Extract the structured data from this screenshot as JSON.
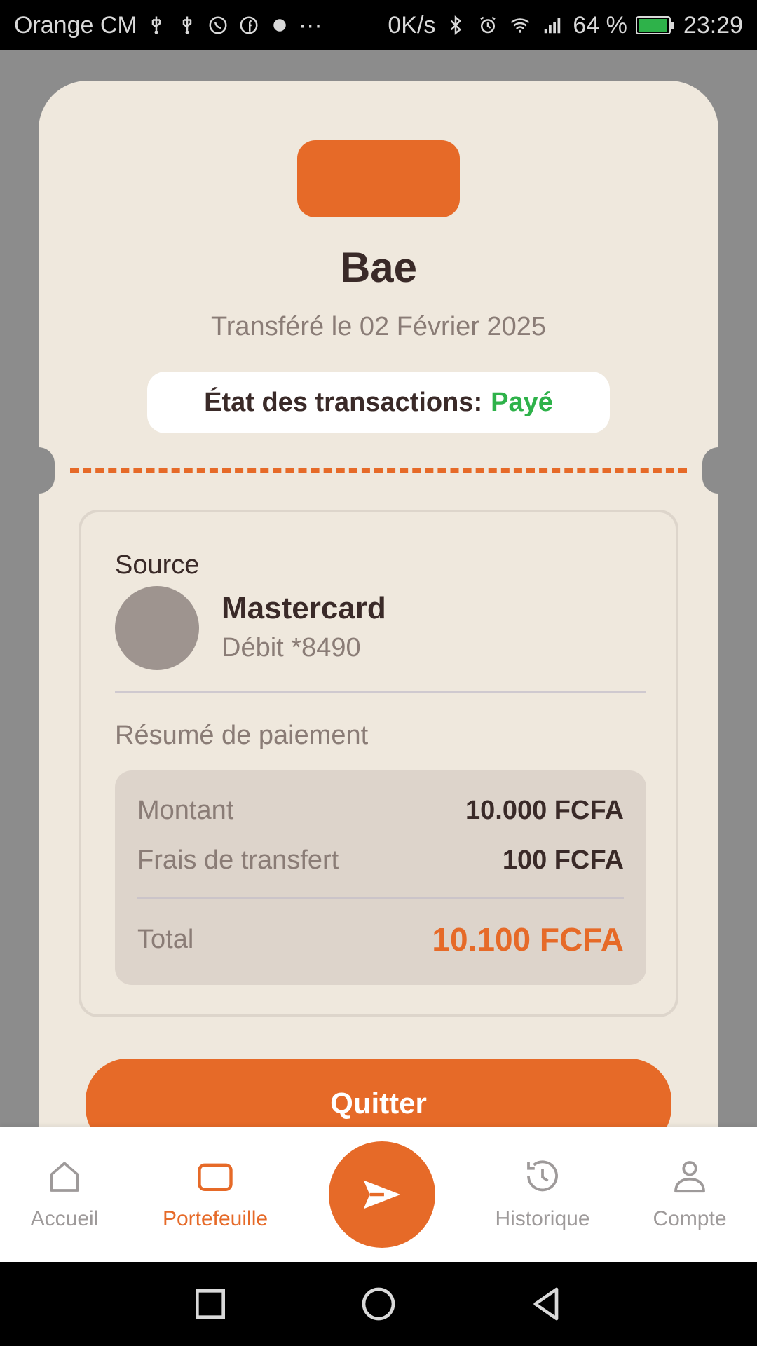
{
  "status_bar": {
    "carrier": "Orange CM",
    "net_speed": "0K/s",
    "battery": "64 %",
    "time": "23:29"
  },
  "transfer": {
    "recipient_name": "Bae",
    "date_text": "Transféré le 02 Février 2025",
    "status_label": "État des transactions:",
    "status_value": "Payé",
    "status_color": "#2eb24a"
  },
  "source": {
    "label": "Source",
    "card_name": "Mastercard",
    "card_detail": "Débit *8490"
  },
  "summary": {
    "title": "Résumé de paiement",
    "rows": [
      {
        "label": "Montant",
        "value": "10.000 FCFA"
      },
      {
        "label": "Frais de transfert",
        "value": "100 FCFA"
      }
    ],
    "total_label": "Total",
    "total_value": "10.100 FCFA"
  },
  "actions": {
    "quit_label": "Quitter"
  },
  "bottom_nav": {
    "items": [
      {
        "label": "Accueil",
        "icon": "home-icon"
      },
      {
        "label": "Portefeuille",
        "icon": "wallet-icon"
      },
      {
        "label": "Historique",
        "icon": "history-icon"
      },
      {
        "label": "Compte",
        "icon": "user-icon"
      }
    ],
    "active": "Portefeuille",
    "fab_icon": "send-icon"
  },
  "colors": {
    "accent": "#e66a28",
    "card_bg": "#efe8dd",
    "text_dark": "#3a2a28",
    "text_muted": "#8a7c76"
  }
}
